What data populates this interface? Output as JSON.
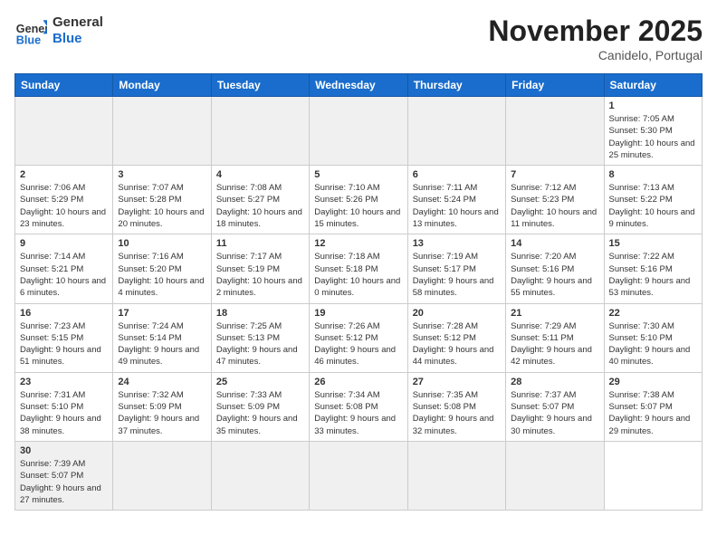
{
  "header": {
    "logo_general": "General",
    "logo_blue": "Blue",
    "month_title": "November 2025",
    "location": "Canidelo, Portugal"
  },
  "weekdays": [
    "Sunday",
    "Monday",
    "Tuesday",
    "Wednesday",
    "Thursday",
    "Friday",
    "Saturday"
  ],
  "days": [
    {
      "num": "",
      "empty": true
    },
    {
      "num": "",
      "empty": true
    },
    {
      "num": "",
      "empty": true
    },
    {
      "num": "",
      "empty": true
    },
    {
      "num": "",
      "empty": true
    },
    {
      "num": "",
      "empty": true
    },
    {
      "num": "1",
      "sunrise": "7:05 AM",
      "sunset": "5:30 PM",
      "daylight": "10 hours and 25 minutes."
    },
    {
      "num": "2",
      "sunrise": "7:06 AM",
      "sunset": "5:29 PM",
      "daylight": "10 hours and 23 minutes."
    },
    {
      "num": "3",
      "sunrise": "7:07 AM",
      "sunset": "5:28 PM",
      "daylight": "10 hours and 20 minutes."
    },
    {
      "num": "4",
      "sunrise": "7:08 AM",
      "sunset": "5:27 PM",
      "daylight": "10 hours and 18 minutes."
    },
    {
      "num": "5",
      "sunrise": "7:10 AM",
      "sunset": "5:26 PM",
      "daylight": "10 hours and 15 minutes."
    },
    {
      "num": "6",
      "sunrise": "7:11 AM",
      "sunset": "5:24 PM",
      "daylight": "10 hours and 13 minutes."
    },
    {
      "num": "7",
      "sunrise": "7:12 AM",
      "sunset": "5:23 PM",
      "daylight": "10 hours and 11 minutes."
    },
    {
      "num": "8",
      "sunrise": "7:13 AM",
      "sunset": "5:22 PM",
      "daylight": "10 hours and 9 minutes."
    },
    {
      "num": "9",
      "sunrise": "7:14 AM",
      "sunset": "5:21 PM",
      "daylight": "10 hours and 6 minutes."
    },
    {
      "num": "10",
      "sunrise": "7:16 AM",
      "sunset": "5:20 PM",
      "daylight": "10 hours and 4 minutes."
    },
    {
      "num": "11",
      "sunrise": "7:17 AM",
      "sunset": "5:19 PM",
      "daylight": "10 hours and 2 minutes."
    },
    {
      "num": "12",
      "sunrise": "7:18 AM",
      "sunset": "5:18 PM",
      "daylight": "10 hours and 0 minutes."
    },
    {
      "num": "13",
      "sunrise": "7:19 AM",
      "sunset": "5:17 PM",
      "daylight": "9 hours and 58 minutes."
    },
    {
      "num": "14",
      "sunrise": "7:20 AM",
      "sunset": "5:16 PM",
      "daylight": "9 hours and 55 minutes."
    },
    {
      "num": "15",
      "sunrise": "7:22 AM",
      "sunset": "5:16 PM",
      "daylight": "9 hours and 53 minutes."
    },
    {
      "num": "16",
      "sunrise": "7:23 AM",
      "sunset": "5:15 PM",
      "daylight": "9 hours and 51 minutes."
    },
    {
      "num": "17",
      "sunrise": "7:24 AM",
      "sunset": "5:14 PM",
      "daylight": "9 hours and 49 minutes."
    },
    {
      "num": "18",
      "sunrise": "7:25 AM",
      "sunset": "5:13 PM",
      "daylight": "9 hours and 47 minutes."
    },
    {
      "num": "19",
      "sunrise": "7:26 AM",
      "sunset": "5:12 PM",
      "daylight": "9 hours and 46 minutes."
    },
    {
      "num": "20",
      "sunrise": "7:28 AM",
      "sunset": "5:12 PM",
      "daylight": "9 hours and 44 minutes."
    },
    {
      "num": "21",
      "sunrise": "7:29 AM",
      "sunset": "5:11 PM",
      "daylight": "9 hours and 42 minutes."
    },
    {
      "num": "22",
      "sunrise": "7:30 AM",
      "sunset": "5:10 PM",
      "daylight": "9 hours and 40 minutes."
    },
    {
      "num": "23",
      "sunrise": "7:31 AM",
      "sunset": "5:10 PM",
      "daylight": "9 hours and 38 minutes."
    },
    {
      "num": "24",
      "sunrise": "7:32 AM",
      "sunset": "5:09 PM",
      "daylight": "9 hours and 37 minutes."
    },
    {
      "num": "25",
      "sunrise": "7:33 AM",
      "sunset": "5:09 PM",
      "daylight": "9 hours and 35 minutes."
    },
    {
      "num": "26",
      "sunrise": "7:34 AM",
      "sunset": "5:08 PM",
      "daylight": "9 hours and 33 minutes."
    },
    {
      "num": "27",
      "sunrise": "7:35 AM",
      "sunset": "5:08 PM",
      "daylight": "9 hours and 32 minutes."
    },
    {
      "num": "28",
      "sunrise": "7:37 AM",
      "sunset": "5:07 PM",
      "daylight": "9 hours and 30 minutes."
    },
    {
      "num": "29",
      "sunrise": "7:38 AM",
      "sunset": "5:07 PM",
      "daylight": "9 hours and 29 minutes."
    },
    {
      "num": "30",
      "sunrise": "7:39 AM",
      "sunset": "5:07 PM",
      "daylight": "9 hours and 27 minutes."
    },
    {
      "num": "",
      "empty": true
    },
    {
      "num": "",
      "empty": true
    },
    {
      "num": "",
      "empty": true
    },
    {
      "num": "",
      "empty": true
    },
    {
      "num": "",
      "empty": true
    }
  ],
  "labels": {
    "sunrise": "Sunrise:",
    "sunset": "Sunset:",
    "daylight": "Daylight:"
  }
}
